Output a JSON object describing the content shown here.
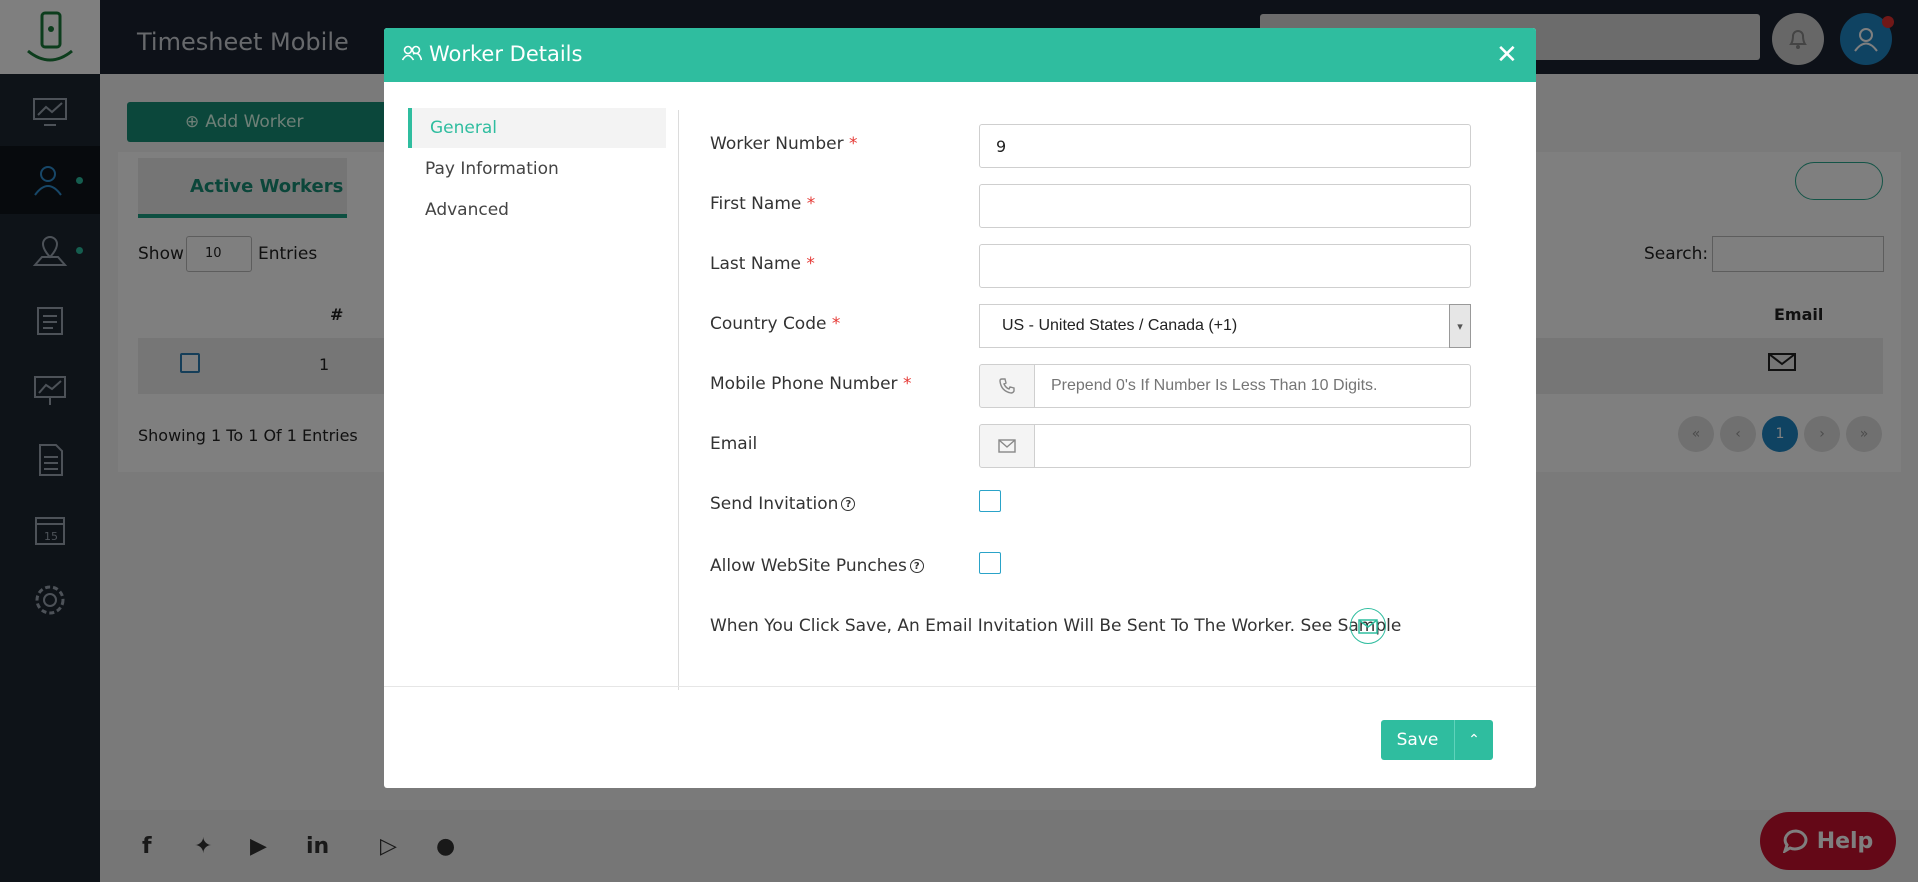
{
  "app": {
    "title": "Timesheet Mobile"
  },
  "toolbar": {
    "add_worker_label": "Add Worker"
  },
  "tabs": {
    "active_workers_label": "Active Workers"
  },
  "table_controls": {
    "show_label": "Show",
    "page_size": "10",
    "entries_label": "Entries",
    "search_label": "Search:",
    "showing_text": "Showing 1 To 1 Of 1 Entries"
  },
  "table": {
    "columns": [
      "#",
      "Email"
    ],
    "rows": [
      {
        "num": "1"
      }
    ]
  },
  "pagination": {
    "current": "1"
  },
  "help": {
    "label": "Help"
  },
  "modal": {
    "title": "Worker Details",
    "nav": [
      "General",
      "Pay Information",
      "Advanced"
    ],
    "fields": {
      "worker_number_label": "Worker Number",
      "worker_number_value": "9",
      "first_name_label": "First Name",
      "last_name_label": "Last Name",
      "country_code_label": "Country Code",
      "country_code_value": "US - United States / Canada (+1)",
      "mobile_label": "Mobile Phone Number",
      "mobile_placeholder": "Prepend 0's If Number Is Less Than 10 Digits.",
      "email_label": "Email",
      "send_invitation_label": "Send Invitation",
      "allow_punches_label": "Allow WebSite Punches",
      "required_mark": "*",
      "help_mark": "?"
    },
    "note": "When You Click Save, An Email Invitation Will Be Sent To The Worker. See Sample",
    "save_label": "Save"
  },
  "colors": {
    "accent": "#2fbd9f",
    "help": "#c8102e",
    "required": "#e53935"
  }
}
